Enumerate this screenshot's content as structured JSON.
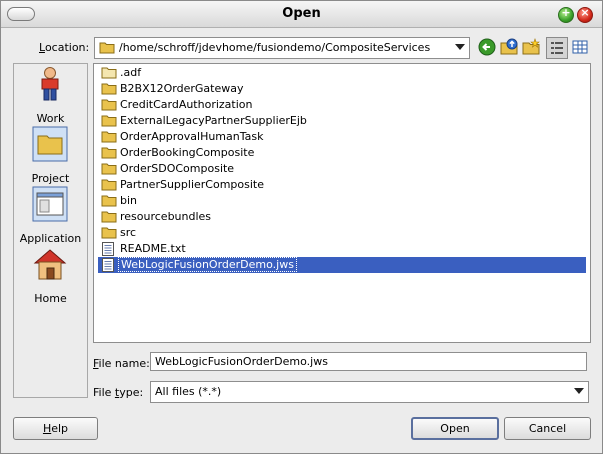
{
  "window": {
    "title": "Open"
  },
  "location": {
    "label_prefix": "",
    "label_mnemonic": "L",
    "label_rest": "ocation:",
    "path": "/home/schroff/jdevhome/fusiondemo/CompositeServices"
  },
  "toolbar": {
    "back_icon": "back-arrow-icon",
    "up_icon": "up-folder-icon",
    "new_folder_icon": "new-folder-icon",
    "list_view_icon": "list-view-icon",
    "details_view_icon": "details-view-icon"
  },
  "places": [
    {
      "label": "Work",
      "icon": "person-icon"
    },
    {
      "label": "Project",
      "icon": "folder-icon"
    },
    {
      "label": "Application",
      "icon": "window-icon"
    },
    {
      "label": "Home",
      "icon": "house-icon"
    }
  ],
  "files": [
    {
      "name": ".adf",
      "type": "folder-light"
    },
    {
      "name": "B2BX12OrderGateway",
      "type": "folder"
    },
    {
      "name": "CreditCardAuthorization",
      "type": "folder"
    },
    {
      "name": "ExternalLegacyPartnerSupplierEjb",
      "type": "folder"
    },
    {
      "name": "OrderApprovalHumanTask",
      "type": "folder"
    },
    {
      "name": "OrderBookingComposite",
      "type": "folder"
    },
    {
      "name": "OrderSDOComposite",
      "type": "folder"
    },
    {
      "name": "PartnerSupplierComposite",
      "type": "folder"
    },
    {
      "name": "bin",
      "type": "folder"
    },
    {
      "name": "resourcebundles",
      "type": "folder"
    },
    {
      "name": "src",
      "type": "folder"
    },
    {
      "name": "README.txt",
      "type": "file"
    },
    {
      "name": "WebLogicFusionOrderDemo.jws",
      "type": "file",
      "selected": true
    }
  ],
  "file_name": {
    "label_mnemonic": "F",
    "label_rest": "ile name:",
    "value": "WebLogicFusionOrderDemo.jws"
  },
  "file_type": {
    "label_prefix": "File ",
    "label_mnemonic": "t",
    "label_rest": "ype:",
    "value": "All files (*.*)"
  },
  "buttons": {
    "help_mnemonic": "H",
    "help_rest": "elp",
    "open": "Open",
    "cancel": "Cancel"
  },
  "colors": {
    "selection": "#3a5fc0",
    "folder": "#e9c24c"
  }
}
